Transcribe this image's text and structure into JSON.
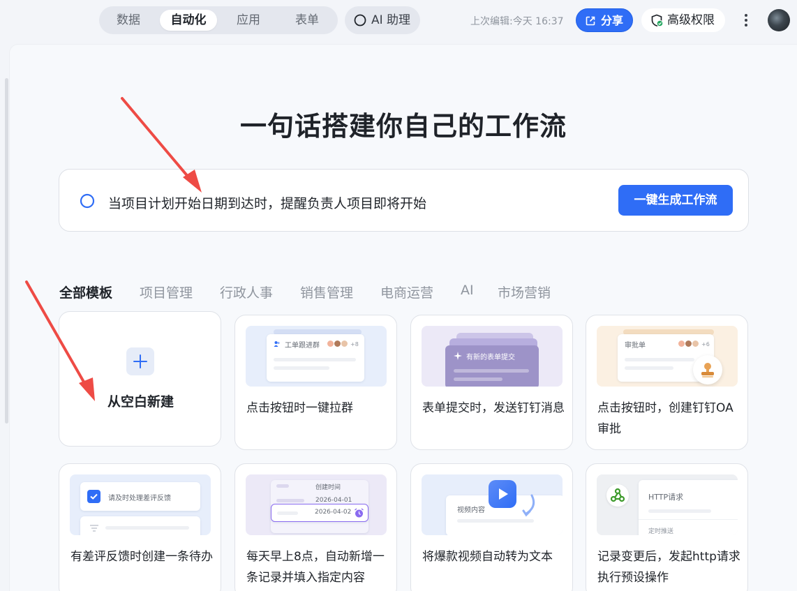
{
  "topbar": {
    "tabs": [
      {
        "label": "数据",
        "active": false
      },
      {
        "label": "自动化",
        "active": true
      },
      {
        "label": "应用",
        "active": false
      },
      {
        "label": "表单",
        "active": false
      }
    ],
    "ai_assistant": "AI 助理",
    "last_edit": "上次编辑:今天 16:37",
    "share": "分享",
    "permission": "高级权限",
    "more_icon": "more-vertical-icon"
  },
  "main": {
    "headline": "一句话搭建你自己的工作流",
    "prompt": {
      "text": "当项目计划开始日期到达时，提醒负责人项目即将开始",
      "generate": "一键生成工作流"
    },
    "template_tabs": [
      {
        "label": "全部模板",
        "active": true
      },
      {
        "label": "项目管理",
        "active": false
      },
      {
        "label": "行政人事",
        "active": false
      },
      {
        "label": "销售管理",
        "active": false
      },
      {
        "label": "电商运营",
        "active": false
      },
      {
        "label": "AI",
        "active": false
      },
      {
        "label": "市场营销",
        "active": false
      }
    ],
    "blank": {
      "title": "从空白新建"
    },
    "cards": [
      {
        "title": "点击按钮时一键拉群",
        "thumb": {
          "label": "工单跟进群",
          "more": "+8"
        }
      },
      {
        "title": "表单提交时，发送钉钉消息",
        "thumb": {
          "label": "有新的表单提交"
        }
      },
      {
        "title": "点击按钮时，创建钉钉OA审批",
        "thumb": {
          "label": "审批单",
          "more": "+6"
        }
      },
      {
        "title": "有差评反馈时创建一条待办",
        "thumb": {
          "label": "请及时处理差评反馈"
        }
      },
      {
        "title": "每天早上8点，自动新增一条记录并填入指定内容",
        "thumb": {
          "header": "创建时间",
          "date1": "2026-04-01",
          "date2": "2026-04-02"
        }
      },
      {
        "title": "将爆款视频自动转为文本",
        "thumb": {
          "label": "视频内容"
        }
      },
      {
        "title": "记录变更后，发起http请求执行预设操作",
        "thumb": {
          "label": "HTTP请求",
          "sub": "定时推送"
        }
      }
    ]
  },
  "colors": {
    "accent": "#2f6df6",
    "annotation_arrow": "#ee4b45"
  }
}
